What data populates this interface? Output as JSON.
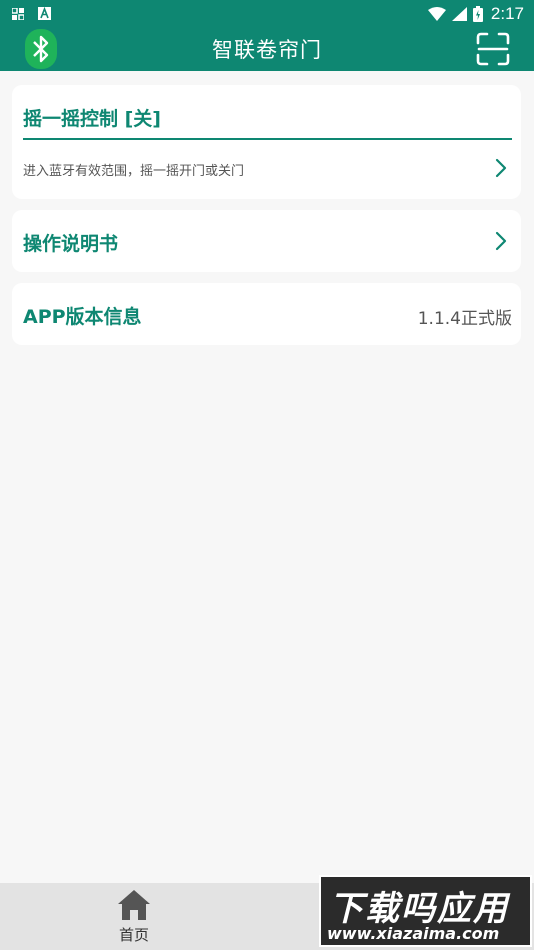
{
  "status_bar": {
    "time": "2:17",
    "icons": [
      "notification-icon",
      "font-icon",
      "wifi-icon",
      "signal-icon",
      "battery-icon"
    ]
  },
  "app_bar": {
    "title": "智联卷帘门",
    "left_icon": "bluetooth-icon",
    "right_icon": "scan-icon",
    "bg_color": "#0e8772"
  },
  "shake_card": {
    "title": "摇一摇控制 [关]",
    "description": "进入蓝牙有效范围，摇一摇开门或关门"
  },
  "manual_card": {
    "label": "操作说明书"
  },
  "version_card": {
    "label": "APP版本信息",
    "value": "1.1.4正式版"
  },
  "bottom_nav": {
    "items": [
      {
        "label": "首页",
        "icon": "home-icon"
      }
    ]
  },
  "watermark": {
    "title": "下载吗应用",
    "url": "www.xiazaima.com"
  },
  "colors": {
    "accent": "#0e8772",
    "bluetooth_badge": "#1fb35a",
    "background": "#f7f7f7"
  }
}
